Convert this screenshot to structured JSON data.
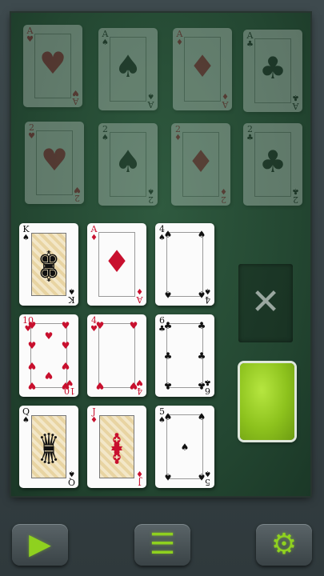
{
  "colors": {
    "table": "#234631",
    "red_suit": "#c8102e",
    "black_suit": "#111111",
    "accent": "#8fd11f"
  },
  "foundation": [
    {
      "rank": "A",
      "suit": "♥",
      "color": "red"
    },
    {
      "rank": "A",
      "suit": "♠",
      "color": "blk"
    },
    {
      "rank": "A",
      "suit": "♦",
      "color": "red"
    },
    {
      "rank": "A",
      "suit": "♣",
      "color": "blk"
    }
  ],
  "targets": [
    {
      "rank": "2",
      "suit": "♥",
      "color": "red"
    },
    {
      "rank": "2",
      "suit": "♠",
      "color": "blk"
    },
    {
      "rank": "2",
      "suit": "♦",
      "color": "red"
    },
    {
      "rank": "2",
      "suit": "♣",
      "color": "blk"
    }
  ],
  "grid": [
    {
      "rank": "K",
      "suit": "♠",
      "color": "blk",
      "face": "♚"
    },
    {
      "rank": "A",
      "suit": "♦",
      "color": "red"
    },
    {
      "rank": "4",
      "suit": "♠",
      "color": "blk",
      "count": 4
    },
    {
      "rank": "10",
      "suit": "♥",
      "color": "red",
      "count": 10
    },
    {
      "rank": "4",
      "suit": "♥",
      "color": "red",
      "count": 4
    },
    {
      "rank": "6",
      "suit": "♣",
      "color": "blk",
      "count": 6
    },
    {
      "rank": "Q",
      "suit": "♠",
      "color": "blk",
      "face": "♛"
    },
    {
      "rank": "J",
      "suit": "♦",
      "color": "red",
      "face": "♝"
    },
    {
      "rank": "5",
      "suit": "♠",
      "color": "blk",
      "count": 5
    }
  ],
  "discard": {
    "icon": "close-icon",
    "glyph": "✕"
  },
  "deck": {
    "icon": "card-back"
  },
  "toolbar": {
    "play": {
      "icon": "play-icon",
      "glyph": "▶"
    },
    "menu": {
      "icon": "menu-icon",
      "glyph": "☰"
    },
    "settings": {
      "icon": "gear-icon",
      "glyph": "⚙"
    }
  }
}
